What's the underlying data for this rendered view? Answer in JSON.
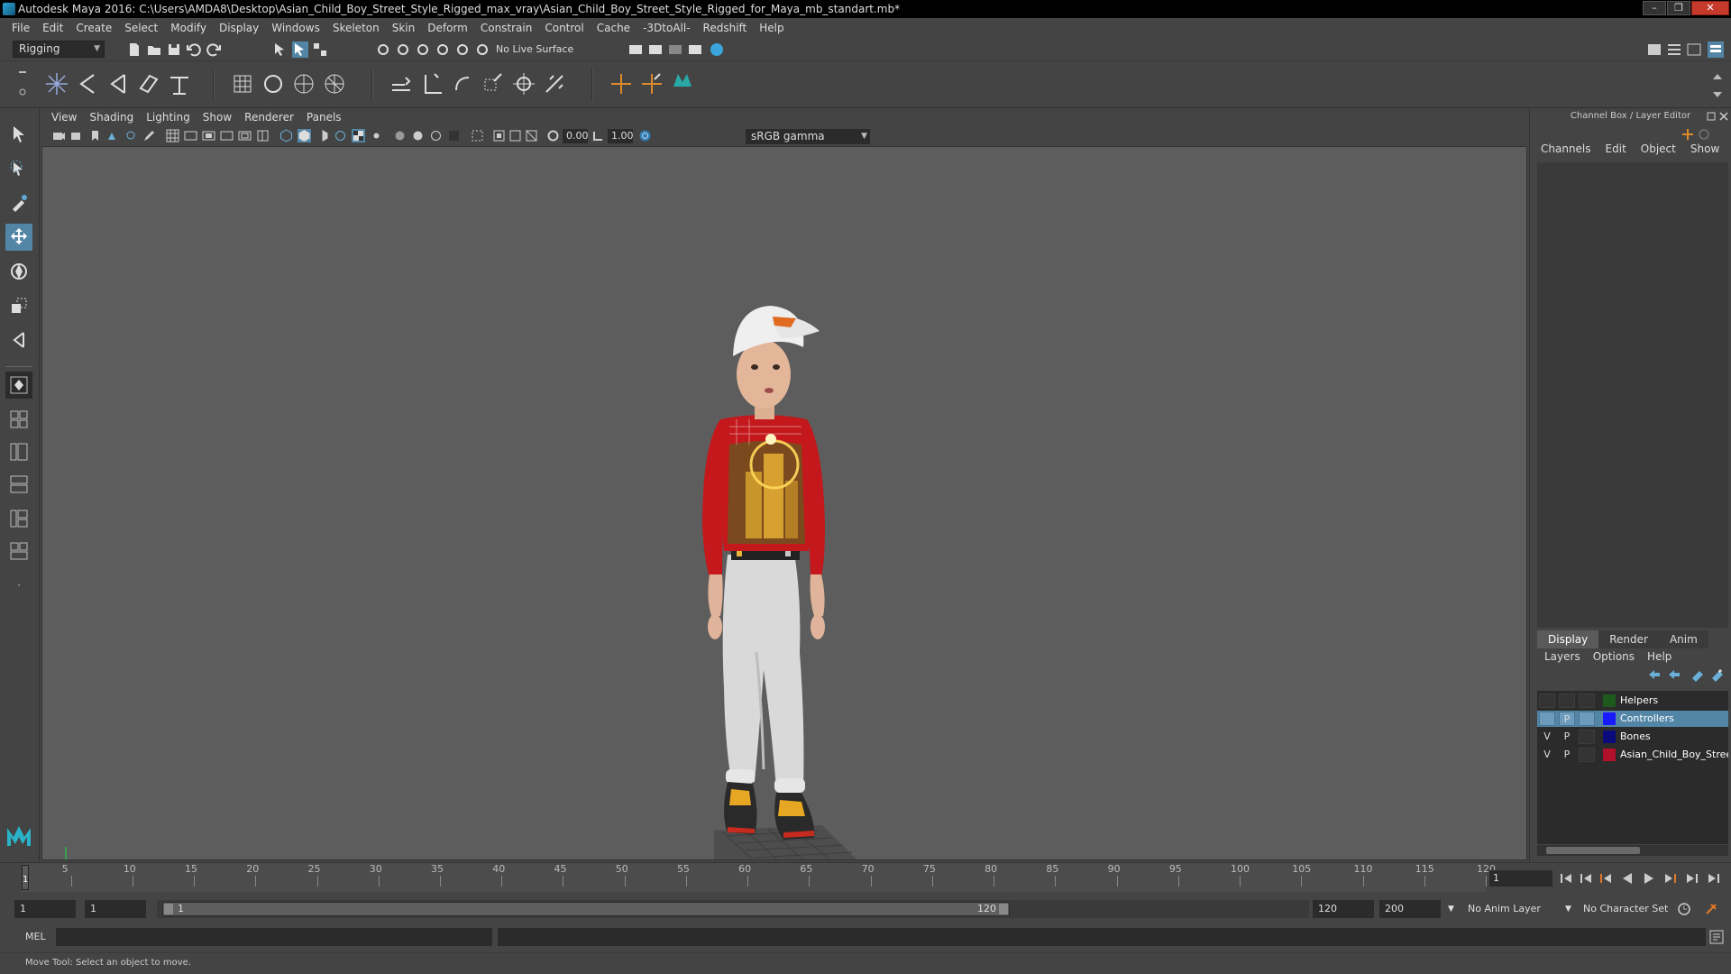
{
  "window": {
    "title": "Autodesk Maya 2016: C:\\Users\\AMDA8\\Desktop\\Asian_Child_Boy_Street_Style_Rigged_max_vray\\Asian_Child_Boy_Street_Style_Rigged_for_Maya_mb_standart.mb*"
  },
  "menubar": [
    "File",
    "Edit",
    "Create",
    "Select",
    "Modify",
    "Display",
    "Windows",
    "Skeleton",
    "Skin",
    "Deform",
    "Constrain",
    "Control",
    "Cache",
    "-3DtoAll-",
    "Redshift",
    "Help"
  ],
  "statusline": {
    "mode": "Rigging",
    "live_surface": "No Live Surface"
  },
  "panel": {
    "menu": [
      "View",
      "Shading",
      "Lighting",
      "Show",
      "Renderer",
      "Panels"
    ],
    "exposure": "0.00",
    "gamma": "1.00",
    "color_space": "sRGB gamma",
    "camera": "persp"
  },
  "channel_box": {
    "header": "Channel Box / Layer Editor",
    "menu": [
      "Channels",
      "Edit",
      "Object",
      "Show"
    ]
  },
  "layer_editor": {
    "tabs": [
      "Display",
      "Render",
      "Anim"
    ],
    "active_tab": "Display",
    "menu": [
      "Layers",
      "Options",
      "Help"
    ],
    "layers": [
      {
        "v": "",
        "p": "",
        "name": "Helpers",
        "color": "#1e5a1e",
        "selected": false
      },
      {
        "v": "",
        "p": "P",
        "name": "Controllers",
        "color": "#1a1aff",
        "selected": true
      },
      {
        "v": "V",
        "p": "P",
        "name": "Bones",
        "color": "#0a0a7a",
        "selected": false
      },
      {
        "v": "V",
        "p": "P",
        "name": "Asian_Child_Boy_Street_Style",
        "color": "#b0102a",
        "selected": false
      }
    ]
  },
  "time_slider": {
    "ticks": [
      "5",
      "10",
      "15",
      "20",
      "25",
      "30",
      "35",
      "40",
      "45",
      "50",
      "55",
      "60",
      "65",
      "70",
      "75",
      "80",
      "85",
      "90",
      "95",
      "100",
      "105",
      "110",
      "115",
      "120"
    ],
    "playhead": "1",
    "current_frame": "1"
  },
  "range": {
    "start": "1",
    "playback_start": "1",
    "slider_start": "1",
    "slider_end": "120",
    "playback_end": "120",
    "end": "200",
    "anim_layer": "No Anim Layer",
    "character_set": "No Character Set"
  },
  "command_line": {
    "label": "MEL"
  },
  "help_line": {
    "text": "Move Tool: Select an object to move."
  },
  "colors": {
    "accent": "#5285a6",
    "viewport_bg": "#5d5d5d",
    "panel_bg": "#444444"
  }
}
